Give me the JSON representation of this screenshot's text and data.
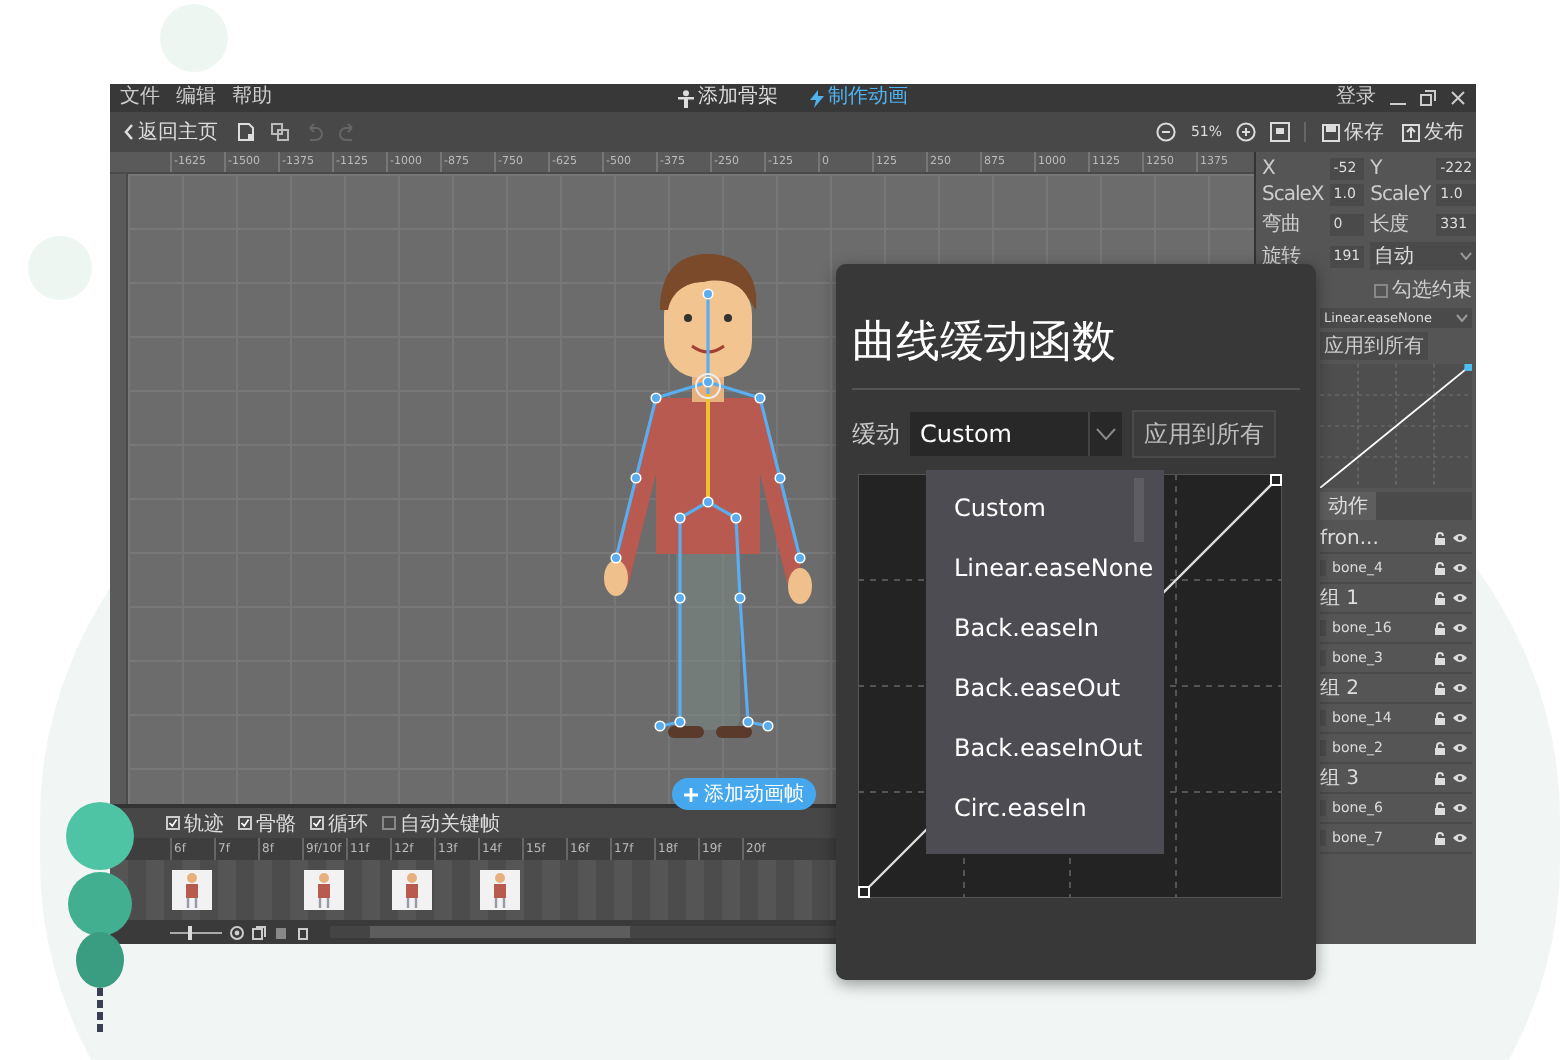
{
  "menu": [
    "文件",
    "编辑",
    "帮助"
  ],
  "mode_tabs": [
    {
      "label": "添加骨架",
      "selected": false
    },
    {
      "label": "制作动画",
      "selected": true
    }
  ],
  "account": "登录",
  "toolbar": {
    "back": "返回主页",
    "zoom": "51%",
    "save": "保存",
    "publish": "发布"
  },
  "ruler": [
    "-1625",
    "-1500",
    "-1375",
    "-1125",
    "-1000",
    "-875",
    "-750",
    "-625",
    "-500",
    "-375",
    "-250",
    "-125",
    "0",
    "125",
    "250",
    "875",
    "1000",
    "1125",
    "1250",
    "1375"
  ],
  "canvas": {
    "add_frame": "添加动画帧"
  },
  "properties": [
    {
      "label": "X",
      "value": "-52"
    },
    {
      "label": "Y",
      "value": "-222"
    },
    {
      "label": "ScaleX",
      "value": "1.0"
    },
    {
      "label": "ScaleY",
      "value": "1.0"
    },
    {
      "label": "弯曲",
      "value": "0"
    },
    {
      "label": "长度",
      "value": "331"
    },
    {
      "label": "旋转",
      "value": "191"
    }
  ],
  "rotation_mode": "自动",
  "constraint": {
    "label": "勾选约束",
    "checked": false
  },
  "easing": {
    "value": "Linear.easeNone",
    "apply": "应用到所有"
  },
  "panel_tabs": [
    {
      "label": "动作",
      "selected": true
    }
  ],
  "layers": [
    {
      "name": "fron...",
      "children": [
        {
          "name": "bone_4"
        }
      ]
    },
    {
      "name": "组 1",
      "children": [
        {
          "name": "bone_16"
        },
        {
          "name": "bone_3"
        }
      ]
    },
    {
      "name": "组 2",
      "children": [
        {
          "name": "bone_14"
        },
        {
          "name": "bone_2"
        }
      ]
    },
    {
      "name": "组 3",
      "children": [
        {
          "name": "bone_6"
        },
        {
          "name": "bone_7"
        }
      ]
    }
  ],
  "timeline": {
    "options": [
      {
        "label": "轨迹",
        "checked": true
      },
      {
        "label": "骨骼",
        "checked": true
      },
      {
        "label": "循环",
        "checked": true
      },
      {
        "label": "自动关键帧",
        "checked": false
      }
    ],
    "ticks": [
      {
        "label": "6f",
        "keyframe": true
      },
      {
        "label": "7f",
        "keyframe": false
      },
      {
        "label": "8f",
        "keyframe": false
      },
      {
        "label": "9f/10f",
        "keyframe": true
      },
      {
        "label": "11f",
        "keyframe": false
      },
      {
        "label": "12f",
        "keyframe": true
      },
      {
        "label": "13f",
        "keyframe": false
      },
      {
        "label": "14f",
        "keyframe": true
      },
      {
        "label": "15f",
        "keyframe": false
      },
      {
        "label": "16f",
        "keyframe": false
      },
      {
        "label": "17f",
        "keyframe": false
      },
      {
        "label": "18f",
        "keyframe": false
      },
      {
        "label": "19f",
        "keyframe": false
      },
      {
        "label": "20f",
        "keyframe": false
      }
    ],
    "zoom_slider": {
      "level": 0.35
    }
  },
  "dialog": {
    "title": "曲线缓动函数",
    "easing_label": "缓动",
    "easing_value": "Custom",
    "apply": "应用到所有",
    "options": [
      {
        "label": "Custom",
        "selected": false
      },
      {
        "label": "Linear.easeNone",
        "selected": false
      },
      {
        "label": "Back.easeIn",
        "selected": false
      },
      {
        "label": "Back.easeOut",
        "selected": false
      },
      {
        "label": "Back.easeInOut",
        "selected": false
      },
      {
        "label": "Circ.easeIn",
        "selected": false
      }
    ]
  }
}
